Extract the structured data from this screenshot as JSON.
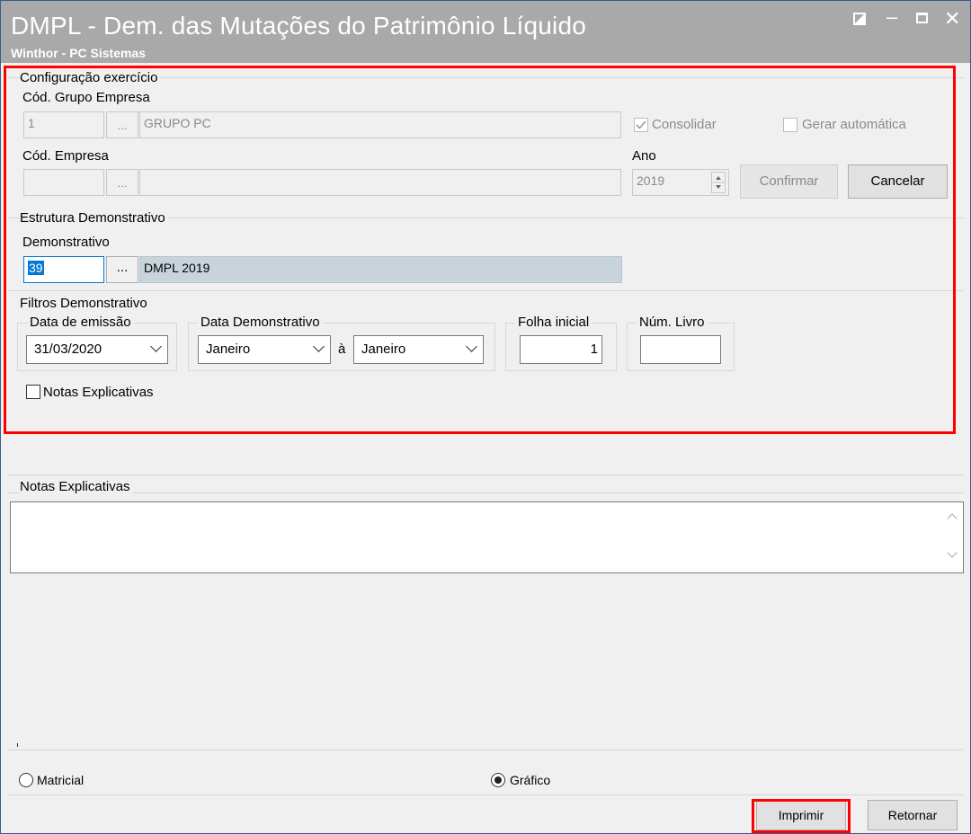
{
  "window": {
    "title": "DMPL - Dem. das Mutações do Patrimônio Líquido",
    "subtitle": "Winthor - PC Sistemas"
  },
  "config": {
    "legend": "Configuração exercício",
    "grupo_label": "Cód. Grupo Empresa",
    "grupo_code": "1",
    "grupo_lookup": "...",
    "grupo_name": "GRUPO PC",
    "consolidar_label": "Consolidar",
    "consolidar_checked": true,
    "gerar_label": "Gerar automática",
    "gerar_checked": false,
    "empresa_label": "Cód. Empresa",
    "empresa_code": "",
    "empresa_lookup": "...",
    "empresa_name": "",
    "ano_label": "Ano",
    "ano_value": "2019",
    "confirmar_label": "Confirmar",
    "cancelar_label": "Cancelar"
  },
  "estrutura": {
    "legend": "Estrutura Demonstrativo",
    "demonstrativo_label": "Demonstrativo",
    "demonstrativo_code": "39",
    "demonstrativo_lookup": "...",
    "demonstrativo_name": "DMPL 2019"
  },
  "filtros": {
    "legend": "Filtros Demonstrativo",
    "data_emissao_label": "Data de emissão",
    "data_emissao_value": "31/03/2020",
    "data_demo_label": "Data Demonstrativo",
    "mes_inicio": "Janeiro",
    "ate_label": "à",
    "mes_fim": "Janeiro",
    "folha_label": "Folha inicial",
    "folha_value": "1",
    "livro_label": "Núm. Livro",
    "livro_value": "",
    "notas_check_label": "Notas Explicativas",
    "notas_checked": false
  },
  "notas": {
    "legend": "Notas Explicativas",
    "text": ""
  },
  "tipo": {
    "matricial_label": "Matricial",
    "grafico_label": "Gráfico",
    "selected": "Gráfico"
  },
  "footer": {
    "imprimir_label": "Imprimir",
    "retornar_label": "Retornar"
  },
  "colors": {
    "titlebar": "#a9a9a9",
    "highlight": "#ff0000",
    "selection": "#0078d7"
  }
}
